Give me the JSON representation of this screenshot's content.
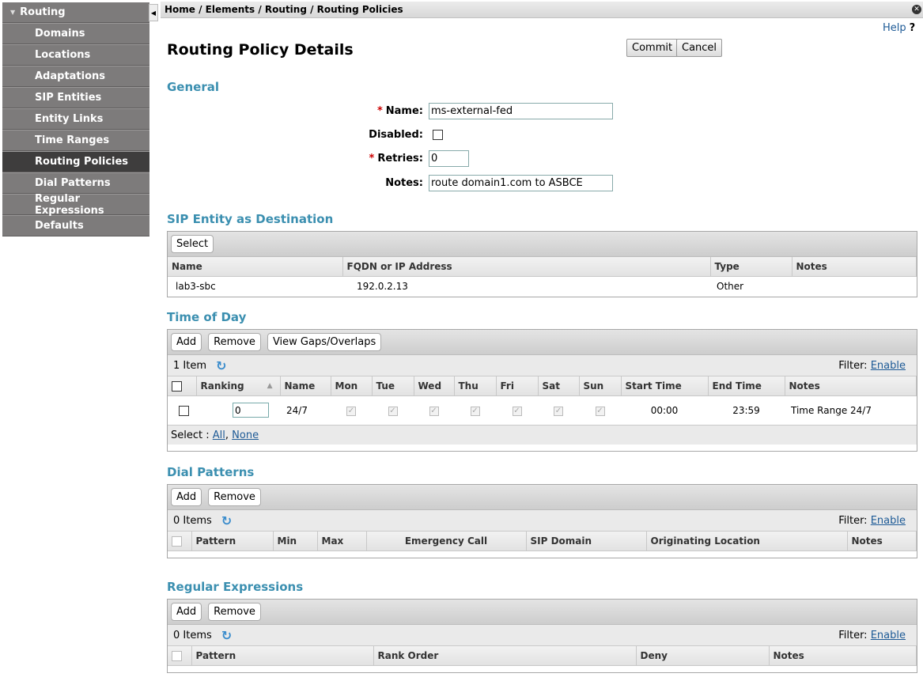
{
  "sidebar": {
    "header": "Routing",
    "items": [
      {
        "label": "Domains"
      },
      {
        "label": "Locations"
      },
      {
        "label": "Adaptations"
      },
      {
        "label": "SIP Entities"
      },
      {
        "label": "Entity Links"
      },
      {
        "label": "Time Ranges"
      },
      {
        "label": "Routing Policies"
      },
      {
        "label": "Dial Patterns"
      },
      {
        "label": "Regular Expressions"
      },
      {
        "label": "Defaults"
      }
    ]
  },
  "breadcrumb": "Home / Elements / Routing / Routing Policies",
  "help": {
    "label": "Help",
    "mark": "?"
  },
  "page": {
    "title": "Routing Policy Details",
    "commit_label": "Commit",
    "cancel_label": "Cancel"
  },
  "general": {
    "title": "General",
    "name_label": "Name:",
    "name_value": "ms-external-fed",
    "disabled_label": "Disabled:",
    "retries_label": "Retries:",
    "retries_value": "0",
    "notes_label": "Notes:",
    "notes_value": "route domain1.com to ASBCE",
    "required_mark": "*"
  },
  "sip_entity": {
    "title": "SIP Entity as Destination",
    "select_label": "Select",
    "columns": [
      "Name",
      "FQDN or IP Address",
      "Type",
      "Notes"
    ],
    "rows": [
      {
        "name": "lab3-sbc",
        "fqdn": "192.0.2.13",
        "type": "Other",
        "notes": ""
      }
    ]
  },
  "time_of_day": {
    "title": "Time of Day",
    "add_label": "Add",
    "remove_label": "Remove",
    "gaps_label": "View Gaps/Overlaps",
    "count": "1 Item",
    "filter_label": "Filter:",
    "filter_link": "Enable",
    "columns": [
      "Ranking",
      "Name",
      "Mon",
      "Tue",
      "Wed",
      "Thu",
      "Fri",
      "Sat",
      "Sun",
      "Start Time",
      "End Time",
      "Notes"
    ],
    "rows": [
      {
        "ranking": "0",
        "name": "24/7",
        "start": "00:00",
        "end": "23:59",
        "notes": "Time Range 24/7"
      }
    ],
    "select_prefix": "Select :",
    "select_all": "All",
    "select_none": "None"
  },
  "dial_patterns": {
    "title": "Dial Patterns",
    "add_label": "Add",
    "remove_label": "Remove",
    "count": "0 Items",
    "filter_label": "Filter:",
    "filter_link": "Enable",
    "columns": [
      "Pattern",
      "Min",
      "Max",
      "Emergency Call",
      "SIP Domain",
      "Originating Location",
      "Notes"
    ]
  },
  "regular_expressions": {
    "title": "Regular Expressions",
    "add_label": "Add",
    "remove_label": "Remove",
    "count": "0 Items",
    "filter_label": "Filter:",
    "filter_link": "Enable",
    "columns": [
      "Pattern",
      "Rank Order",
      "Deny",
      "Notes"
    ]
  }
}
